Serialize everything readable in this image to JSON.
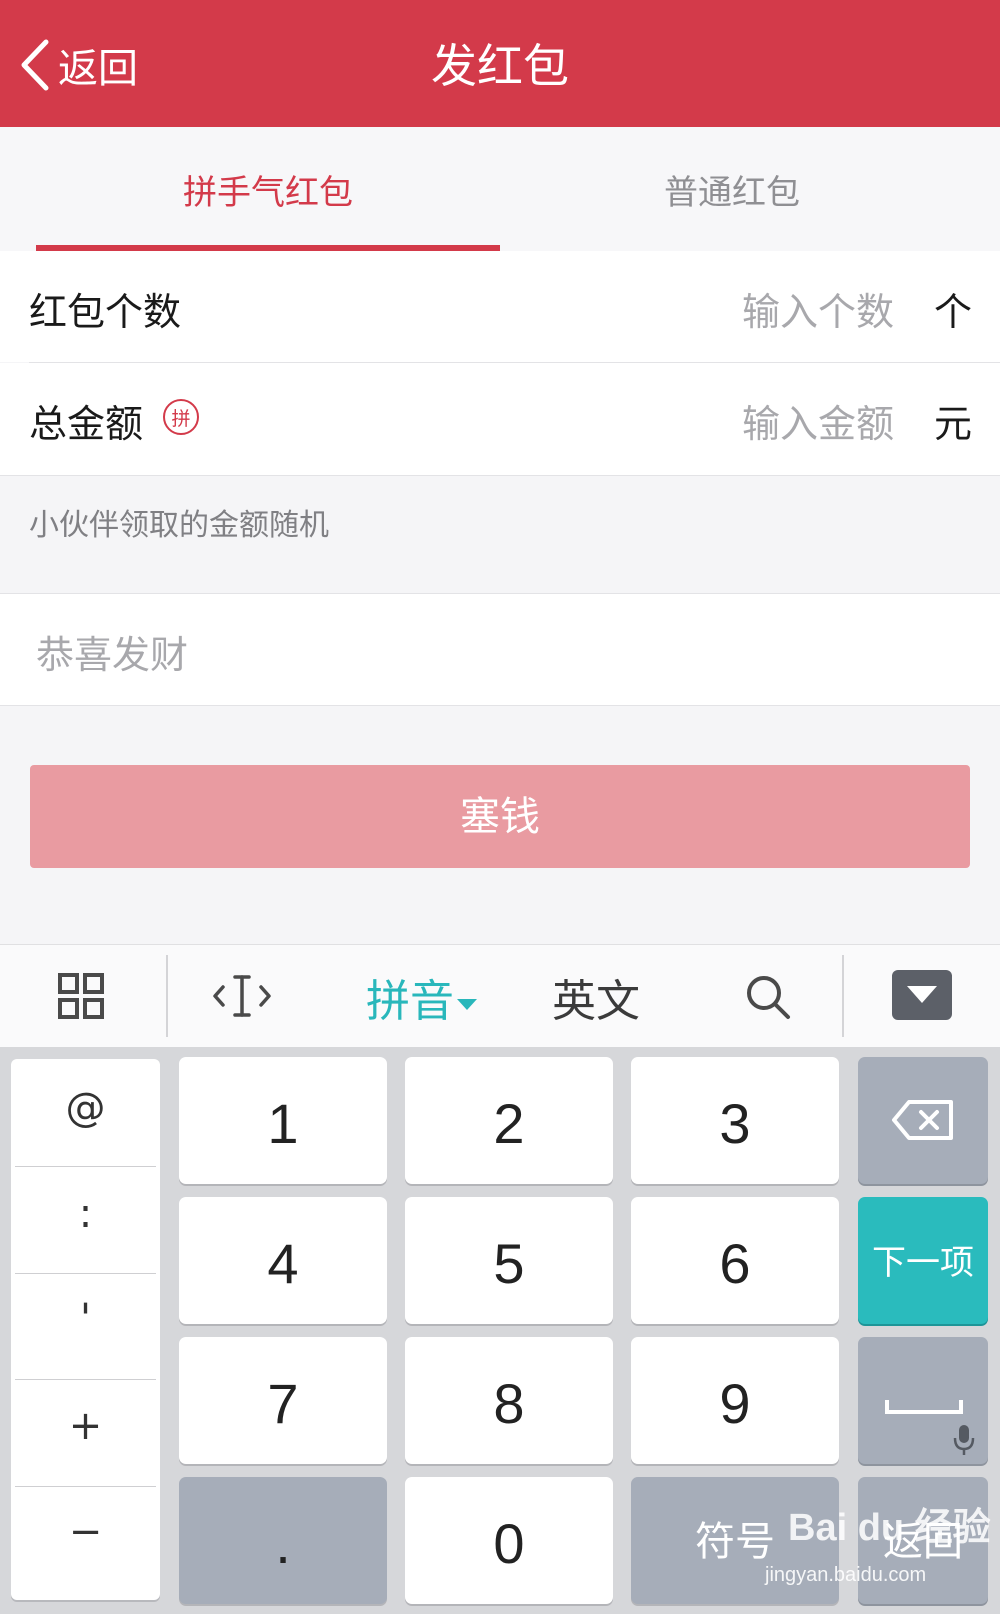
{
  "header": {
    "back_label": "返回",
    "title": "发红包"
  },
  "tabs": [
    {
      "label": "拼手气红包",
      "active": true
    },
    {
      "label": "普通红包",
      "active": false
    }
  ],
  "form": {
    "count": {
      "label": "红包个数",
      "placeholder": "输入个数",
      "unit": "个"
    },
    "amount": {
      "label": "总金额",
      "badge": "拼",
      "placeholder": "输入金额",
      "unit": "元"
    },
    "hint": "小伙伴领取的金额随机",
    "message_placeholder": "恭喜发财",
    "submit_label": "塞钱"
  },
  "keyboard": {
    "toolbar": {
      "pinyin_label": "拼音",
      "english_label": "英文",
      "icons": [
        "grid-icon",
        "cursor-icon",
        "search-icon",
        "hide-keyboard-icon"
      ]
    },
    "symbols": [
      "@",
      ":",
      "'",
      "+",
      "−"
    ],
    "digits": [
      "1",
      "2",
      "3",
      "4",
      "5",
      "6",
      "7",
      "8",
      "9",
      "0"
    ],
    "dot": ".",
    "next_label": "下一项",
    "symbols_label": "符号",
    "return_label": "返回"
  },
  "watermark": {
    "brand": "Bai du 经验",
    "url": "jingyan.baidu.com"
  },
  "colors": {
    "accent": "#d33a4a",
    "submit_disabled": "#e99ba1",
    "keyboard_teal": "#2abbbd"
  }
}
